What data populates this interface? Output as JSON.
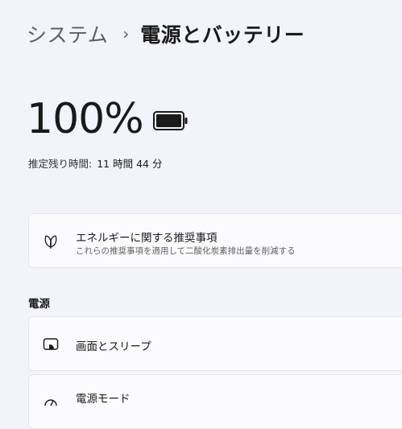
{
  "breadcrumb": {
    "parent": "システム",
    "separator": "›",
    "current": "電源とバッテリー"
  },
  "battery": {
    "percent_label": "100%",
    "level": 1.0,
    "remaining_label": "推定残り時間:",
    "remaining_value": "11 時間 44 分"
  },
  "recommendations": {
    "icon": "leaf-icon",
    "title": "エネルギーに関する推奨事項",
    "description": "これらの推奨事項を適用して二酸化炭素排出量を削減する"
  },
  "power_section": {
    "title": "電源",
    "items": [
      {
        "icon": "screen-sleep-icon",
        "label": "画面とスリープ"
      },
      {
        "icon": "power-mode-icon",
        "label": "電源モード"
      }
    ]
  }
}
